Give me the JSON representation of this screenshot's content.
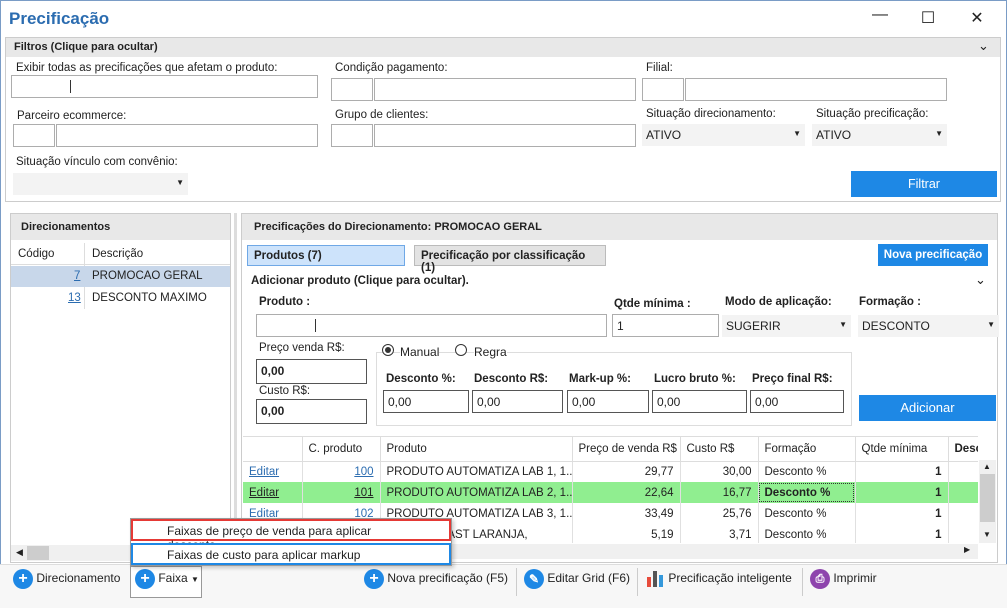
{
  "window": {
    "title": "Precificação",
    "minimize": "—",
    "maximize": "☐",
    "close": "✕"
  },
  "filtros": {
    "header": "Filtros (Clique para ocultar)",
    "exibir_label": "Exibir todas as precificações que afetam o produto:",
    "condicao_label": "Condição pagamento:",
    "filial_label": "Filial:",
    "parceiro_label": "Parceiro ecommerce:",
    "grupo_label": "Grupo de clientes:",
    "sit_direc_label": "Situação direcionamento:",
    "sit_direc_value": "ATIVO",
    "sit_prec_label": "Situação precificação:",
    "sit_prec_value": "ATIVO",
    "sit_vinculo_label": "Situação vínculo com convênio:",
    "filtrar": "Filtrar"
  },
  "direcionamentos": {
    "header": "Direcionamentos",
    "col_codigo": "Código",
    "col_descricao": "Descrição",
    "rows": [
      {
        "codigo": "7",
        "descricao": "PROMOCAO GERAL"
      },
      {
        "codigo": "13",
        "descricao": "DESCONTO MAXIMO"
      }
    ]
  },
  "precificacoes": {
    "header": "Precificações do Direcionamento: PROMOCAO GERAL",
    "tab_produtos": "Produtos (7)",
    "tab_classificacao": "Precificação por classificação (1)",
    "nova": "Nova precificação",
    "adicionar_header": "Adicionar produto (Clique para ocultar).",
    "produto_label": "Produto :",
    "qtde_label": "Qtde mínima :",
    "qtde_value": "1",
    "modo_label": "Modo de aplicação:",
    "modo_value": "SUGERIR",
    "formacao_label": "Formação :",
    "formacao_value": "DESCONTO",
    "preco_venda_label": "Preço venda R$:",
    "preco_venda_value": "0,00",
    "custo_label": "Custo R$:",
    "custo_value": "0,00",
    "radio_manual": "Manual",
    "radio_regra": "Regra",
    "desc_pct_label": "Desconto %:",
    "desc_pct_value": "0,00",
    "desc_rs_label": "Desconto R$:",
    "desc_rs_value": "0,00",
    "markup_label": "Mark-up %:",
    "markup_value": "0,00",
    "lucro_label": "Lucro bruto %:",
    "lucro_value": "0,00",
    "preco_final_label": "Preço final R$:",
    "preco_final_value": "0,00",
    "adicionar": "Adicionar"
  },
  "grid": {
    "columns": [
      "",
      "C. produto",
      "Produto",
      "Preço de venda R$",
      "Custo R$",
      "Formação",
      "Qtde mínima",
      "Descont"
    ],
    "rows": [
      {
        "acao": "Editar",
        "codigo": "100",
        "produto": "PRODUTO AUTOMATIZA LAB 1, 1...",
        "preco": "29,77",
        "custo": "30,00",
        "formacao": "Desconto %",
        "qtde": "1"
      },
      {
        "acao": "Editar",
        "codigo": "101",
        "produto": "PRODUTO AUTOMATIZA LAB 2, 1...",
        "preco": "22,64",
        "custo": "16,77",
        "formacao": "Desconto %",
        "qtde": "1"
      },
      {
        "acao": "Editar",
        "codigo": "102",
        "produto": "PRODUTO AUTOMATIZA LAB 3, 1...",
        "preco": "33,49",
        "custo": "25,76",
        "formacao": "Desconto %",
        "qtde": "1"
      },
      {
        "acao": "",
        "codigo": "",
        "produto": "PAST LARANJA,",
        "preco": "5,19",
        "custo": "3,71",
        "formacao": "Desconto %",
        "qtde": "1"
      }
    ]
  },
  "popup": {
    "item1": "Faixas de preço de venda para aplicar desconto",
    "item2": "Faixas de custo para aplicar markup"
  },
  "toolbar": {
    "direcionamento": "Direcionamento",
    "faixa": "Faixa",
    "nova": "Nova precificação (F5)",
    "editar_grid": "Editar Grid (F6)",
    "inteligente": "Precificação inteligente",
    "imprimir": "Imprimir"
  }
}
